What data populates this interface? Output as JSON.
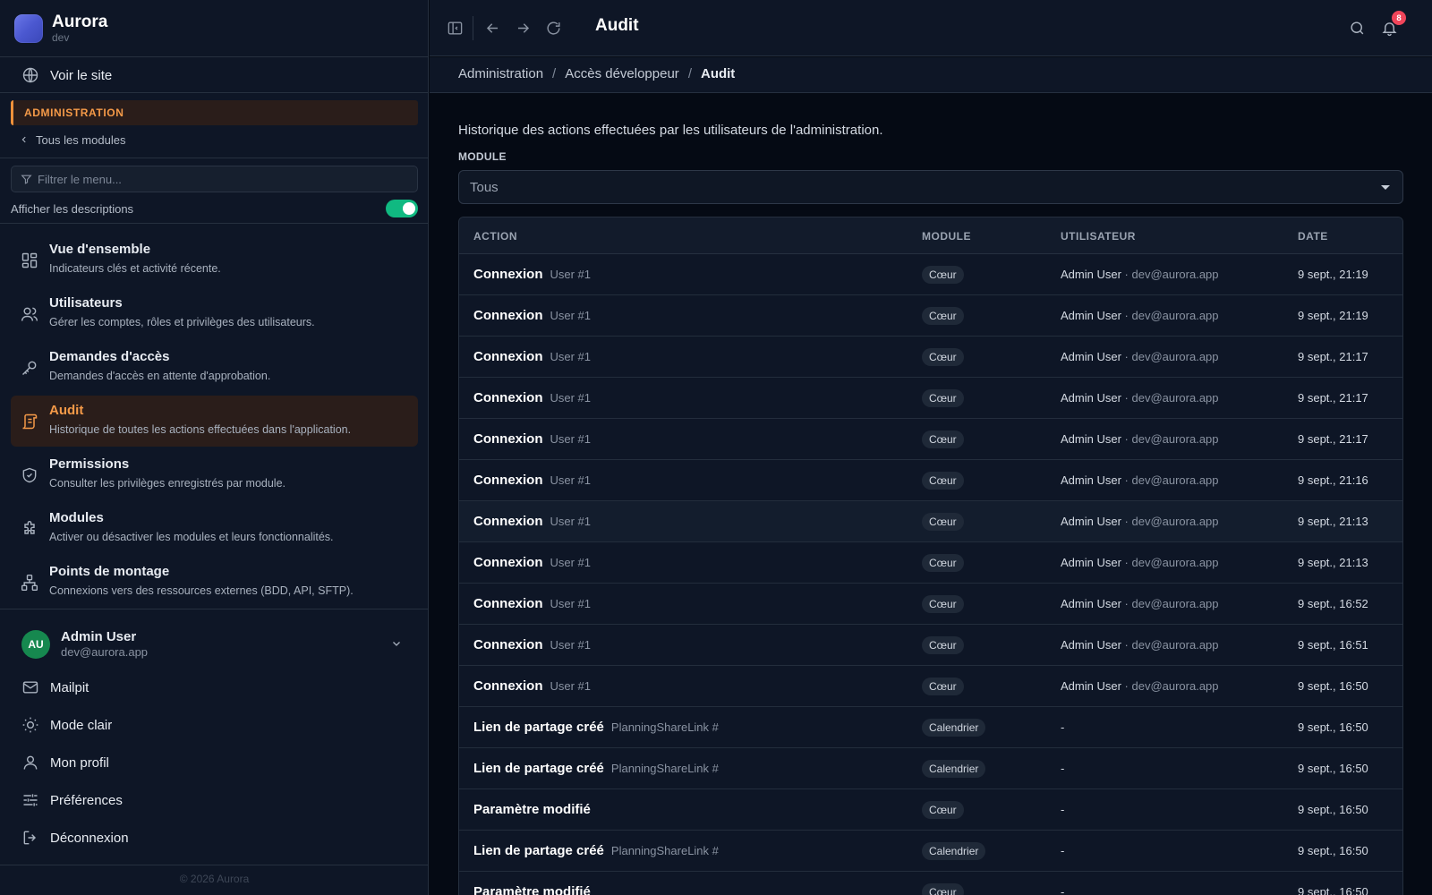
{
  "app": {
    "name": "Aurora",
    "env": "dev",
    "copyright": "© 2026 Aurora"
  },
  "sidebar": {
    "view_site": "Voir le site",
    "section_label": "ADMINISTRATION",
    "all_modules": "Tous les modules",
    "filter_placeholder": "Filtrer le menu...",
    "show_descriptions": "Afficher les descriptions",
    "show_descriptions_on": true,
    "items": [
      {
        "title": "Vue d'ensemble",
        "desc": "Indicateurs clés et activité récente.",
        "icon": "dashboard-icon"
      },
      {
        "title": "Utilisateurs",
        "desc": "Gérer les comptes, rôles et privilèges des utilisateurs.",
        "icon": "users-icon"
      },
      {
        "title": "Demandes d'accès",
        "desc": "Demandes d'accès en attente d'approbation.",
        "icon": "key-icon"
      },
      {
        "title": "Audit",
        "desc": "Historique de toutes les actions effectuées dans l'application.",
        "icon": "scroll-icon",
        "active": true
      },
      {
        "title": "Permissions",
        "desc": "Consulter les privilèges enregistrés par module.",
        "icon": "shield-icon"
      },
      {
        "title": "Modules",
        "desc": "Activer ou désactiver les modules et leurs fonctionnalités.",
        "icon": "puzzle-icon"
      },
      {
        "title": "Points de montage",
        "desc": "Connexions vers des ressources externes (BDD, API, SFTP).",
        "icon": "network-icon"
      }
    ],
    "user": {
      "initials": "AU",
      "name": "Admin User",
      "email": "dev@aurora.app"
    },
    "bottom": {
      "mailpit": "Mailpit",
      "light_mode": "Mode clair",
      "profile": "Mon profil",
      "preferences": "Préférences",
      "logout": "Déconnexion"
    }
  },
  "topbar": {
    "title": "Audit",
    "notifications": "8"
  },
  "breadcrumb": [
    "Administration",
    "Accès développeur",
    "Audit"
  ],
  "content": {
    "description": "Historique des actions effectuées par les utilisateurs de l'administration.",
    "module_filter_label": "MODULE",
    "module_filter_value": "Tous"
  },
  "table": {
    "columns": {
      "action": "ACTION",
      "module": "MODULE",
      "user": "UTILISATEUR",
      "date": "DATE"
    },
    "rows": [
      {
        "action": "Connexion",
        "target": "User #1",
        "module": "Cœur",
        "user_name": "Admin User",
        "user_email": "dev@aurora.app",
        "date": "9 sept., 21:19"
      },
      {
        "action": "Connexion",
        "target": "User #1",
        "module": "Cœur",
        "user_name": "Admin User",
        "user_email": "dev@aurora.app",
        "date": "9 sept., 21:19"
      },
      {
        "action": "Connexion",
        "target": "User #1",
        "module": "Cœur",
        "user_name": "Admin User",
        "user_email": "dev@aurora.app",
        "date": "9 sept., 21:17"
      },
      {
        "action": "Connexion",
        "target": "User #1",
        "module": "Cœur",
        "user_name": "Admin User",
        "user_email": "dev@aurora.app",
        "date": "9 sept., 21:17"
      },
      {
        "action": "Connexion",
        "target": "User #1",
        "module": "Cœur",
        "user_name": "Admin User",
        "user_email": "dev@aurora.app",
        "date": "9 sept., 21:17"
      },
      {
        "action": "Connexion",
        "target": "User #1",
        "module": "Cœur",
        "user_name": "Admin User",
        "user_email": "dev@aurora.app",
        "date": "9 sept., 21:16"
      },
      {
        "action": "Connexion",
        "target": "User #1",
        "module": "Cœur",
        "user_name": "Admin User",
        "user_email": "dev@aurora.app",
        "date": "9 sept., 21:13",
        "highlight": true
      },
      {
        "action": "Connexion",
        "target": "User #1",
        "module": "Cœur",
        "user_name": "Admin User",
        "user_email": "dev@aurora.app",
        "date": "9 sept., 21:13"
      },
      {
        "action": "Connexion",
        "target": "User #1",
        "module": "Cœur",
        "user_name": "Admin User",
        "user_email": "dev@aurora.app",
        "date": "9 sept., 16:52"
      },
      {
        "action": "Connexion",
        "target": "User #1",
        "module": "Cœur",
        "user_name": "Admin User",
        "user_email": "dev@aurora.app",
        "date": "9 sept., 16:51"
      },
      {
        "action": "Connexion",
        "target": "User #1",
        "module": "Cœur",
        "user_name": "Admin User",
        "user_email": "dev@aurora.app",
        "date": "9 sept., 16:50"
      },
      {
        "action": "Lien de partage créé",
        "target": "PlanningShareLink #",
        "module": "Calendrier",
        "user_name": "-",
        "user_email": "",
        "date": "9 sept., 16:50"
      },
      {
        "action": "Lien de partage créé",
        "target": "PlanningShareLink #",
        "module": "Calendrier",
        "user_name": "-",
        "user_email": "",
        "date": "9 sept., 16:50"
      },
      {
        "action": "Paramètre modifié",
        "target": "",
        "module": "Cœur",
        "user_name": "-",
        "user_email": "",
        "date": "9 sept., 16:50"
      },
      {
        "action": "Lien de partage créé",
        "target": "PlanningShareLink #",
        "module": "Calendrier",
        "user_name": "-",
        "user_email": "",
        "date": "9 sept., 16:50"
      },
      {
        "action": "Paramètre modifié",
        "target": "",
        "module": "Cœur",
        "user_name": "-",
        "user_email": "",
        "date": "9 sept., 16:50"
      }
    ]
  },
  "colors": {
    "accent": "#f59a48",
    "toggle_on": "#10b981",
    "notif_badge": "#f0455a",
    "avatar": "#16884f"
  }
}
